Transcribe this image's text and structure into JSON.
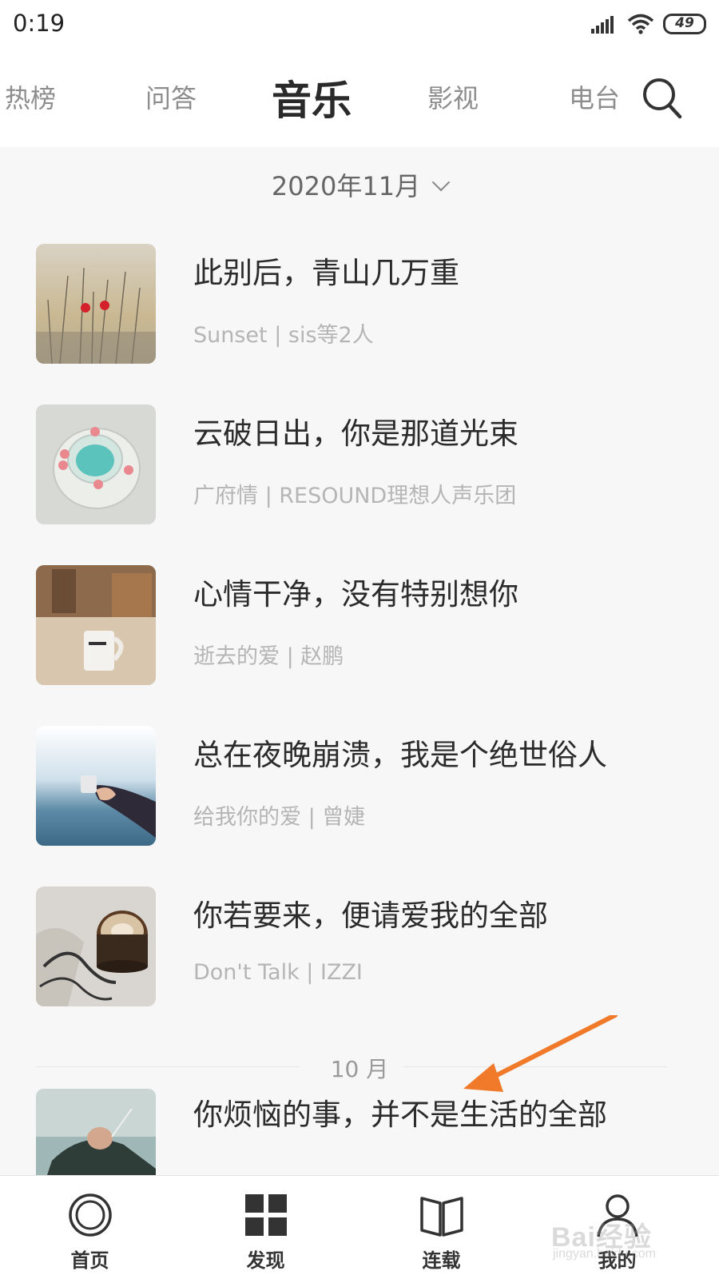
{
  "status_bar": {
    "time": "0:19",
    "battery": "49"
  },
  "tabs": [
    {
      "label": "热榜"
    },
    {
      "label": "问答"
    },
    {
      "label": "音乐",
      "active": true
    },
    {
      "label": "影视"
    },
    {
      "label": "电台"
    }
  ],
  "month_selector": {
    "label": "2020年11月"
  },
  "songs": [
    {
      "title": "此别后，青山几万重",
      "meta": "Sunset | sis等2人"
    },
    {
      "title": "云破日出，你是那道光束",
      "meta": "广府情 | RESOUND理想人声乐团"
    },
    {
      "title": "心情干净，没有特别想你",
      "meta": "逝去的爱 | 赵鹏"
    },
    {
      "title": "总在夜晚崩溃，我是个绝世俗人",
      "meta": "给我你的爱 | 曾婕"
    },
    {
      "title": "你若要来，便请爱我的全部",
      "meta": "Don't Talk | IZZI"
    }
  ],
  "section_divider": {
    "label": "10 月"
  },
  "partial_song": {
    "title": "你烦恼的事，并不是生活的全部"
  },
  "bottom_nav": [
    {
      "label": "首页",
      "icon": "home-circle-icon"
    },
    {
      "label": "发现",
      "icon": "grid-icon"
    },
    {
      "label": "连载",
      "icon": "book-icon"
    },
    {
      "label": "我的",
      "icon": "person-icon"
    }
  ],
  "watermark": {
    "text": "Bai经验",
    "sub": "jingyan.baidu.com"
  },
  "colors": {
    "accent_arrow": "#f07a2a",
    "text_primary": "#2b2b2b",
    "text_secondary": "#b5b5b5"
  }
}
